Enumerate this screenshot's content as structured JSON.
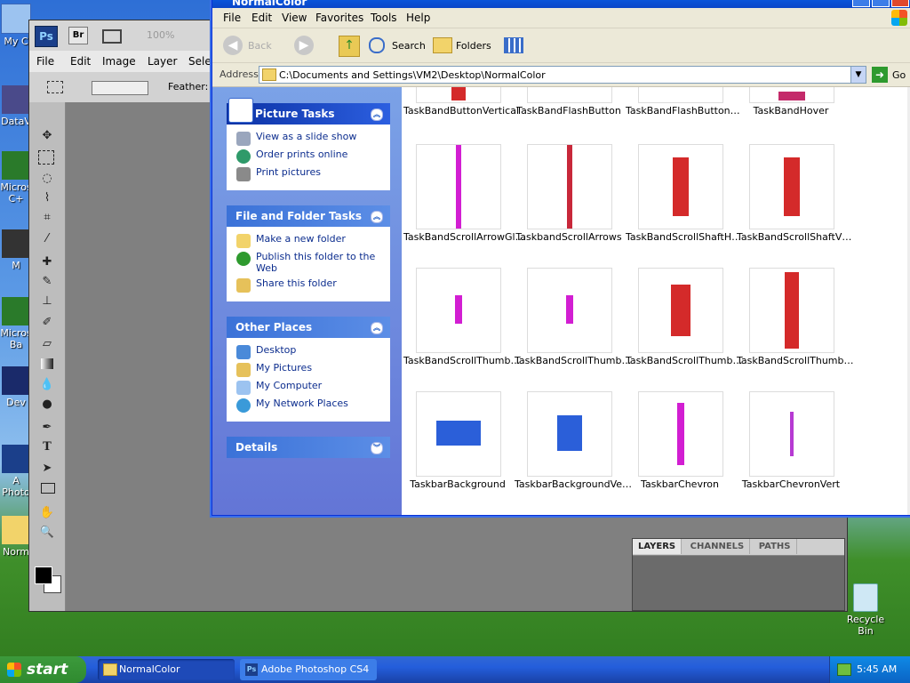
{
  "desktop": {
    "icons": [
      {
        "label": "My C"
      },
      {
        "label": "DataV"
      },
      {
        "label": "Micros C+"
      },
      {
        "label": "M"
      },
      {
        "label": "Micros Ba"
      },
      {
        "label": "Dev"
      },
      {
        "label": "A Photo"
      },
      {
        "label": "Norm"
      },
      {
        "label": "Recycle Bin"
      }
    ]
  },
  "photoshop": {
    "logo": "Ps",
    "bridge": "Br",
    "zoom": "100%",
    "menu": [
      "File",
      "Edit",
      "Image",
      "Layer",
      "Selec"
    ],
    "feather_label": "Feather:",
    "panel_tabs": [
      "LAYERS",
      "CHANNELS",
      "PATHS"
    ]
  },
  "explorer": {
    "title": "NormalColor",
    "menu": [
      "File",
      "Edit",
      "View",
      "Favorites",
      "Tools",
      "Help"
    ],
    "toolbar": {
      "back": "Back",
      "search": "Search",
      "folders": "Folders"
    },
    "address_label": "Address",
    "address_value": "C:\\Documents and Settings\\VM2\\Desktop\\NormalColor",
    "go_label": "Go",
    "panels": {
      "picture_tasks": {
        "title": "Picture Tasks",
        "items": [
          "View as a slide show",
          "Order prints online",
          "Print pictures"
        ]
      },
      "file_folder_tasks": {
        "title": "File and Folder Tasks",
        "items": [
          "Make a new folder",
          "Publish this folder to the Web",
          "Share this folder"
        ]
      },
      "other_places": {
        "title": "Other Places",
        "items": [
          "Desktop",
          "My Pictures",
          "My Computer",
          "My Network Places"
        ]
      },
      "details": {
        "title": "Details"
      }
    },
    "files": [
      {
        "name": "TaskBandButtonVertical"
      },
      {
        "name": "TaskBandFlashButton"
      },
      {
        "name": "TaskBandFlashButton…"
      },
      {
        "name": "TaskBandHover"
      },
      {
        "name": "TaskBandScrollArrowGl…"
      },
      {
        "name": "TaskbandScrollArrows"
      },
      {
        "name": "TaskBandScrollShaftH…"
      },
      {
        "name": "TaskBandScrollShaftV…"
      },
      {
        "name": "TaskBandScrollThumb…"
      },
      {
        "name": "TaskBandScrollThumb…"
      },
      {
        "name": "TaskBandScrollThumb…"
      },
      {
        "name": "TaskBandScrollThumb…"
      },
      {
        "name": "TaskbarBackground"
      },
      {
        "name": "TaskbarBackgroundVe…"
      },
      {
        "name": "TaskbarChevron"
      },
      {
        "name": "TaskbarChevronVert"
      }
    ]
  },
  "taskbar": {
    "start": "start",
    "tasks": [
      {
        "label": "NormalColor"
      },
      {
        "label": "Adobe Photoshop CS4"
      }
    ],
    "clock": "5:45 AM"
  },
  "colors": {
    "xp_blue": "#245edb",
    "start_green": "#3c9a3c",
    "thumb_red": "#d42a2a",
    "thumb_magenta": "#d21ed2",
    "thumb_blue": "#2b5fd9"
  }
}
